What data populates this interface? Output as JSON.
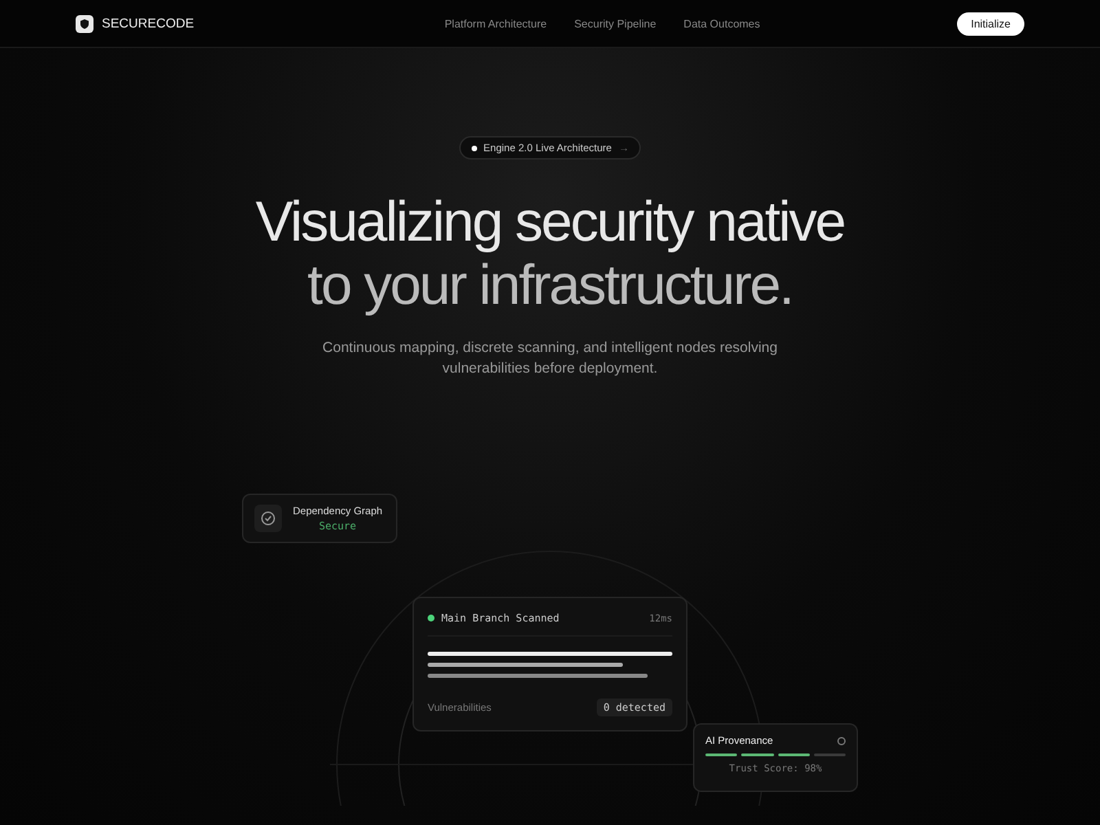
{
  "nav": {
    "brand": "SECURECODE",
    "links": [
      "Platform Architecture",
      "Security Pipeline",
      "Data Outcomes"
    ],
    "cta": "Initialize"
  },
  "hero": {
    "badge": {
      "label": "Engine 2.0 Live Architecture",
      "arrow": "→"
    },
    "title_lines": [
      "Visualizing security native",
      "to your infrastructure."
    ],
    "subtitle": "Continuous mapping, discrete scanning, and intelligent nodes resolving vulnerabilities before deployment."
  },
  "dependency_card": {
    "title": "Dependency Graph",
    "status": "Secure"
  },
  "scan_card": {
    "title": "Main Branch Scanned",
    "time": "12ms",
    "metric_label": "Vulnerabilities",
    "metric_value": "0 detected"
  },
  "provenance_card": {
    "title": "AI Provenance",
    "segments": [
      {
        "filled": true
      },
      {
        "filled": true
      },
      {
        "filled": true
      },
      {
        "filled": false
      }
    ],
    "score": "Trust Score: 98%"
  }
}
